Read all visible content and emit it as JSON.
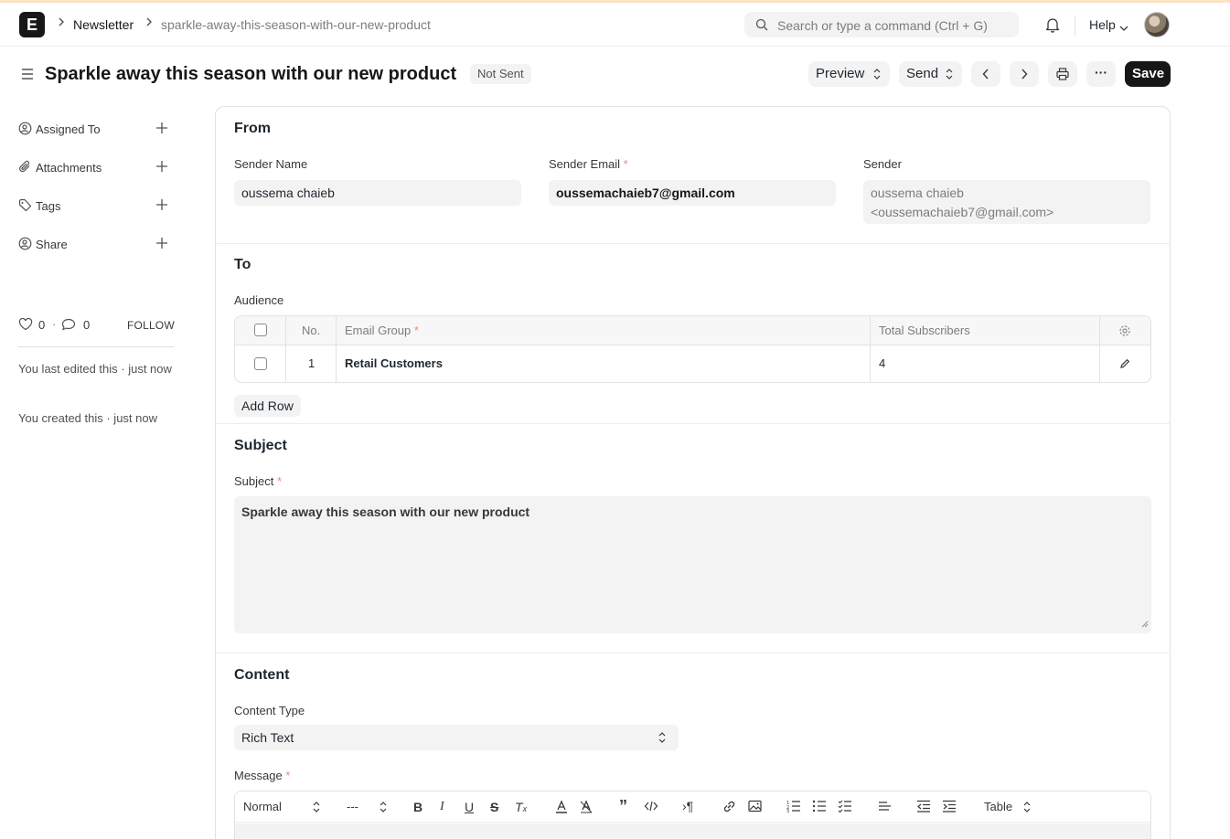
{
  "navbar": {
    "logo_letter": "E",
    "breadcrumbs": [
      "Newsletter",
      "sparkle-away-this-season-with-our-new-product"
    ],
    "search_placeholder": "Search or type a command (Ctrl + G)",
    "help_label": "Help"
  },
  "page": {
    "title": "Sparkle away this season with our new product",
    "status": "Not Sent",
    "actions": {
      "preview": "Preview",
      "send": "Send",
      "save": "Save",
      "more": "···"
    }
  },
  "sidebar": {
    "items": [
      {
        "label": "Assigned To",
        "icon": "user-assign-icon"
      },
      {
        "label": "Attachments",
        "icon": "paperclip-icon"
      },
      {
        "label": "Tags",
        "icon": "tag-icon"
      },
      {
        "label": "Share",
        "icon": "share-user-icon"
      }
    ],
    "likes": "0",
    "comments": "0",
    "follow_label": "FOLLOW",
    "last_edited": "You last edited this · just now",
    "created": "You created this · just now"
  },
  "form": {
    "from": {
      "title": "From",
      "sender_name_label": "Sender Name",
      "sender_name": "oussema chaieb",
      "sender_email_label": "Sender Email",
      "sender_email": "oussemachaieb7@gmail.com",
      "sender_label": "Sender",
      "sender_line1": "oussema chaieb",
      "sender_line2": "<oussemachaieb7@gmail.com>"
    },
    "to": {
      "title": "To",
      "audience_label": "Audience",
      "columns": {
        "no": "No.",
        "email_group": "Email Group",
        "total": "Total Subscribers"
      },
      "rows": [
        {
          "no": "1",
          "email_group": "Retail Customers",
          "total": "4"
        }
      ],
      "add_row": "Add Row"
    },
    "subject": {
      "title": "Subject",
      "label": "Subject",
      "value": "Sparkle away this season with our new product"
    },
    "content": {
      "title": "Content",
      "content_type_label": "Content Type",
      "content_type": "Rich Text",
      "message_label": "Message",
      "toolbar": {
        "style": "Normal",
        "size": "---",
        "table": "Table"
      }
    }
  },
  "required_mark": "*"
}
